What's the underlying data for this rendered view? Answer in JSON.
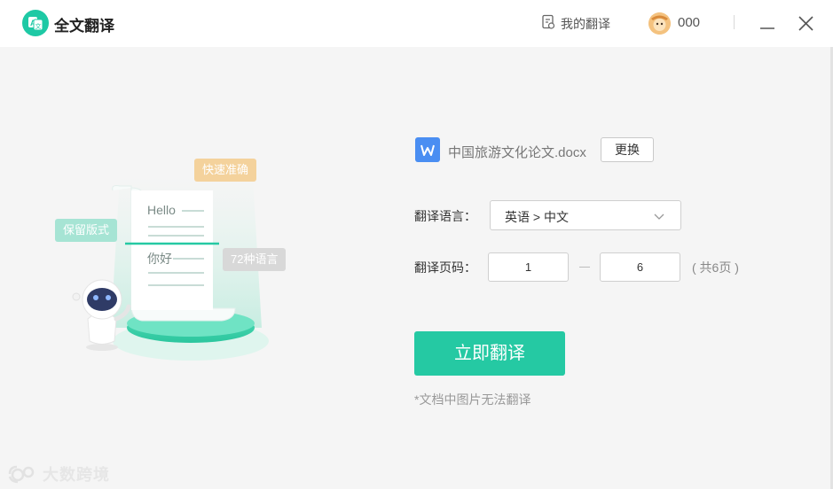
{
  "app": {
    "title": "全文翻译",
    "logo_text": "A文",
    "accent_color": "#25c9a3"
  },
  "header": {
    "my_translations_label": "我的翻译",
    "username": "000",
    "icons": [
      "document-icon",
      "avatar",
      "minimize-icon",
      "close-icon"
    ]
  },
  "illustration": {
    "tag_fast": "快速准确",
    "tag_format": "保留版式",
    "tag_languages": "72种语言",
    "doc_hello": "Hello",
    "doc_nihao": "你好"
  },
  "file": {
    "name": "中国旅游文化论文.docx",
    "change_label": "更换",
    "icon": "word-icon"
  },
  "form": {
    "language_label": "翻译语言：",
    "language_value": "英语 > 中文",
    "pages_label": "翻译页码：",
    "page_from": "1",
    "page_to": "6",
    "total_pages": "( 共6页 )"
  },
  "actions": {
    "translate_label": "立即翻译"
  },
  "note": "*文档中图片无法翻译",
  "watermark": "大数跨境"
}
